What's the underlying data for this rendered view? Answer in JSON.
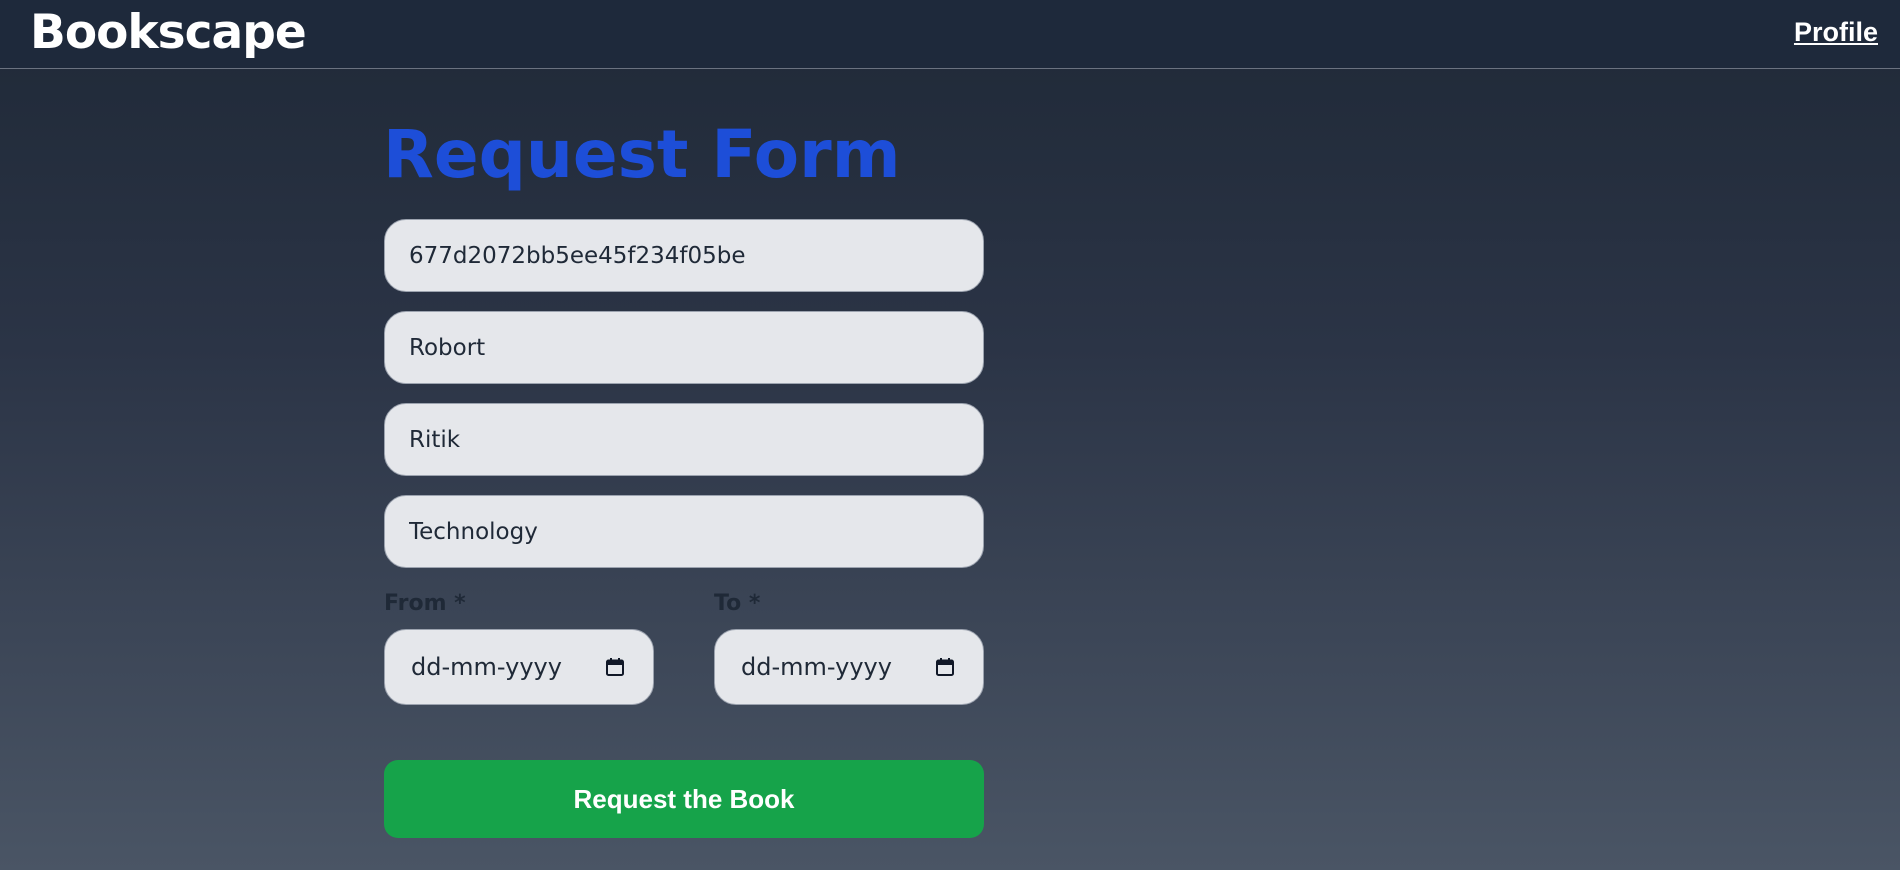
{
  "navbar": {
    "brand": "Bookscape",
    "profile_link": "Profile"
  },
  "form": {
    "title": "Request Form",
    "fields": [
      {
        "value": "677d2072bb5ee45f234f05be"
      },
      {
        "value": "Robort"
      },
      {
        "value": "Ritik"
      },
      {
        "value": "Technology"
      }
    ],
    "from": {
      "label": "From *",
      "placeholder": "dd-mm-yyyy",
      "icon": "calendar-icon"
    },
    "to": {
      "label": "To *",
      "placeholder": "dd-mm-yyyy",
      "icon": "calendar-icon"
    },
    "submit_label": "Request the Book"
  },
  "colors": {
    "title": "#1d4ed8",
    "submit": "#16a34a",
    "navbar": "#1e293b",
    "field_bg": "#e5e7eb"
  }
}
